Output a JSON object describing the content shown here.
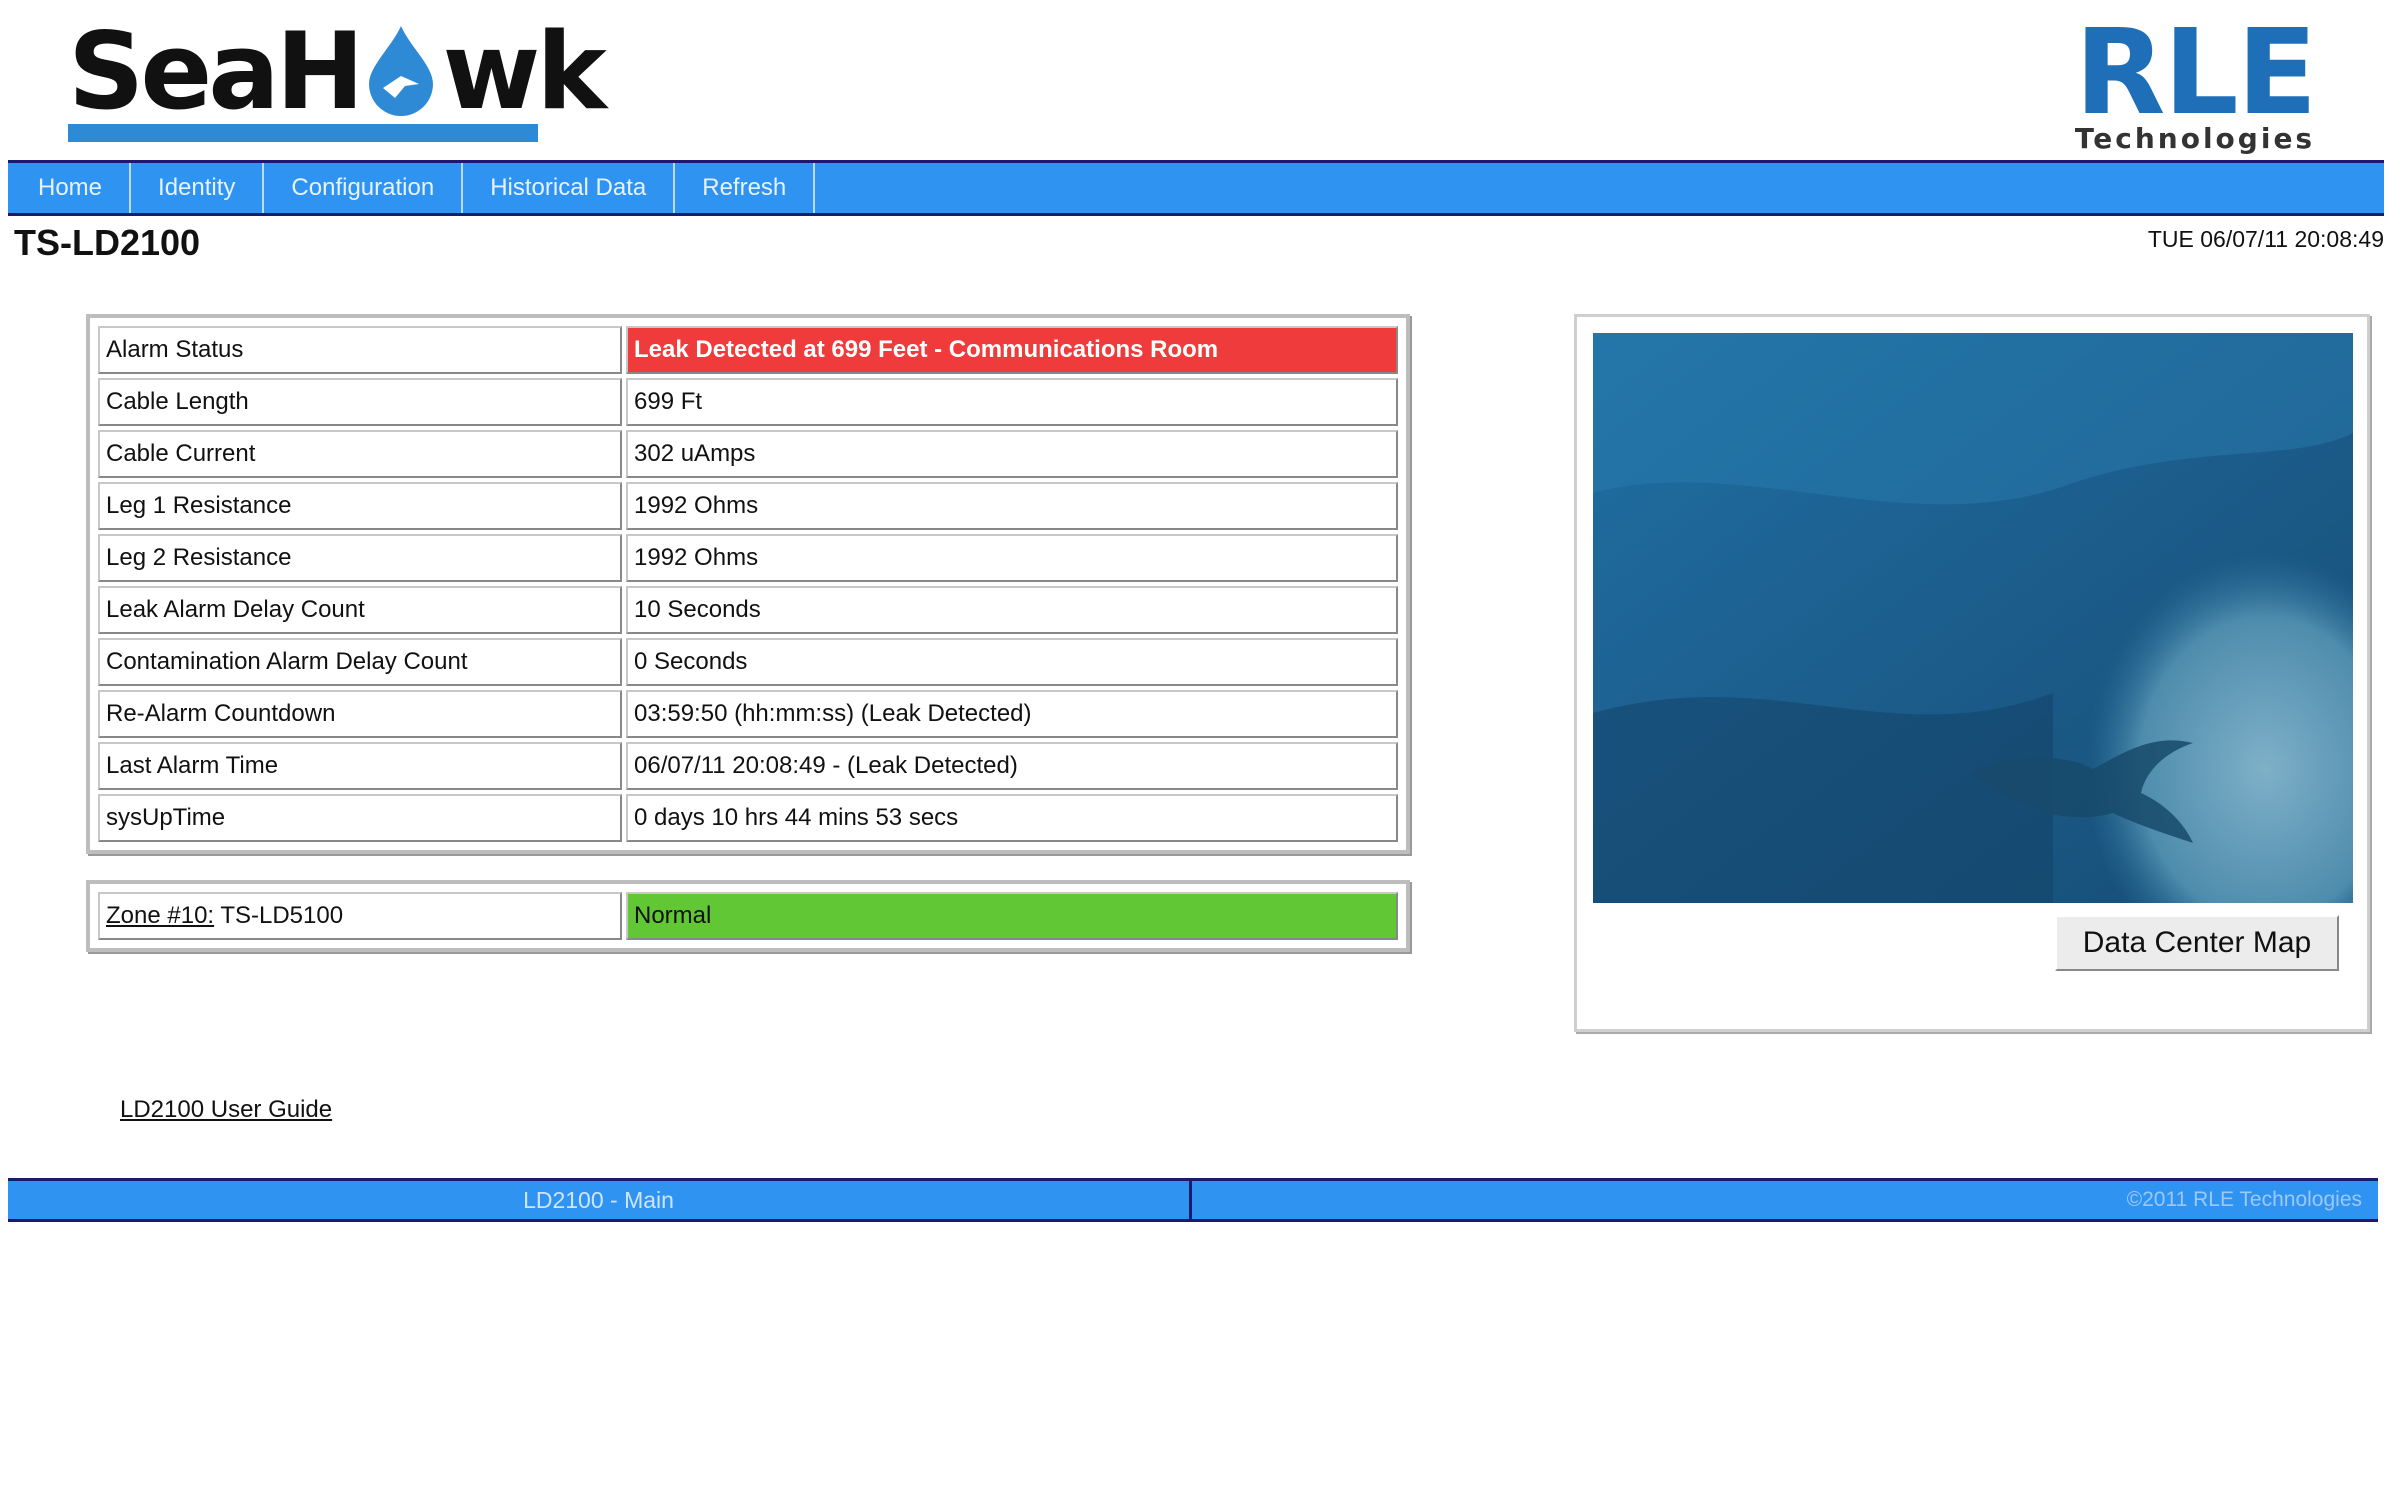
{
  "header": {
    "brand_left": "SeaHawk",
    "brand_right": "RLE",
    "brand_right_sub": "Technologies"
  },
  "nav": {
    "items": [
      "Home",
      "Identity",
      "Configuration",
      "Historical Data",
      "Refresh"
    ]
  },
  "page": {
    "title": "TS-LD2100",
    "datetime": "TUE 06/07/11 20:08:49"
  },
  "status_table": {
    "rows": [
      {
        "label": "Alarm Status",
        "value": "Leak Detected at 699 Feet - Communications Room"
      },
      {
        "label": "Cable Length",
        "value": "699 Ft"
      },
      {
        "label": "Cable Current",
        "value": "302 uAmps"
      },
      {
        "label": "Leg 1 Resistance",
        "value": "1992 Ohms"
      },
      {
        "label": "Leg 2 Resistance",
        "value": "1992 Ohms"
      },
      {
        "label": "Leak Alarm Delay Count",
        "value": "10 Seconds"
      },
      {
        "label": "Contamination Alarm Delay Count",
        "value": "0 Seconds"
      },
      {
        "label": "Re-Alarm Countdown",
        "value": "03:59:50 (hh:mm:ss) (Leak Detected)"
      },
      {
        "label": "Last Alarm Time",
        "value": "06/07/11 20:08:49  -  (Leak Detected)"
      },
      {
        "label": "sysUpTime",
        "value": "0 days 10 hrs 44 mins 53 secs"
      }
    ],
    "alarm_color": "#ef3b3b"
  },
  "zone": {
    "link_text": "Zone #10:",
    "device": "TS-LD5100",
    "status": "Normal",
    "status_color": "#62c734"
  },
  "image_panel": {
    "button_label": "Data Center Map"
  },
  "links": {
    "user_guide": "LD2100 User Guide"
  },
  "footer": {
    "left": "LD2100 - Main",
    "right": "©2011 RLE Technologies"
  },
  "colors": {
    "nav_blue": "#2f93f1",
    "nav_border": "#1a1a6e",
    "brand_blue": "#1f6fb8"
  }
}
